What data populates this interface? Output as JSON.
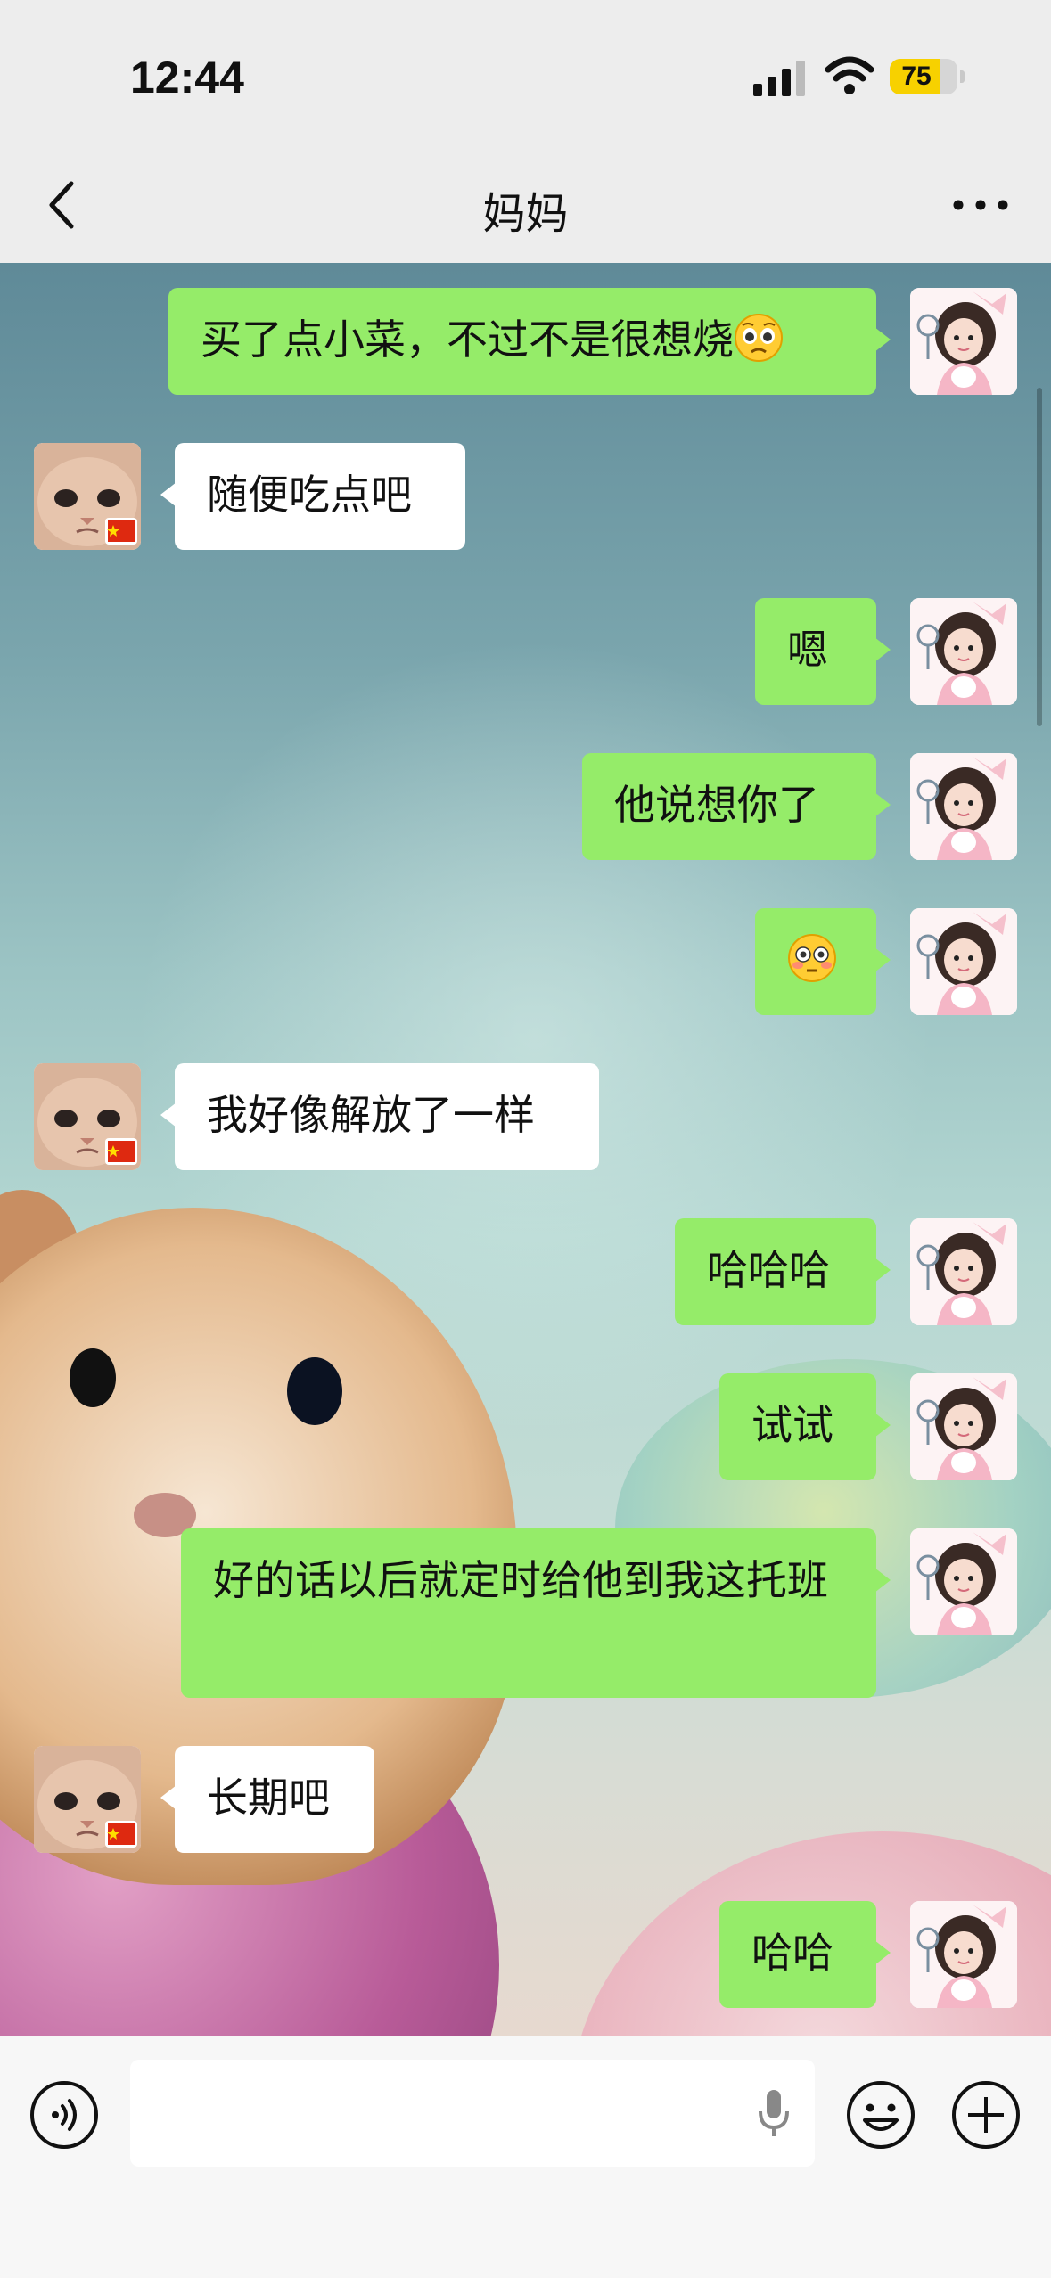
{
  "status_bar": {
    "time": "12:44",
    "battery": "75"
  },
  "nav": {
    "title": "妈妈"
  },
  "messages": [
    {
      "from": "me",
      "text": "买了点小菜，不过不是很想烧",
      "emoji": "pleading-face"
    },
    {
      "from": "mom",
      "text": "随便吃点吧"
    },
    {
      "from": "me",
      "text": "嗯"
    },
    {
      "from": "me",
      "text": "他说想你了"
    },
    {
      "from": "me",
      "text": "",
      "emoji": "flushed-face"
    },
    {
      "from": "mom",
      "text": "我好像解放了一样"
    },
    {
      "from": "me",
      "text": "哈哈哈"
    },
    {
      "from": "me",
      "text": "试试"
    },
    {
      "from": "me",
      "text": "好的话以后就定时给他到我这托班"
    },
    {
      "from": "mom",
      "text": "长期吧"
    },
    {
      "from": "me",
      "text": "哈哈"
    }
  ],
  "input": {
    "placeholder": ""
  },
  "colors": {
    "my_bubble": "#95ec69",
    "their_bubble": "#ffffff",
    "battery": "#f7d100"
  }
}
